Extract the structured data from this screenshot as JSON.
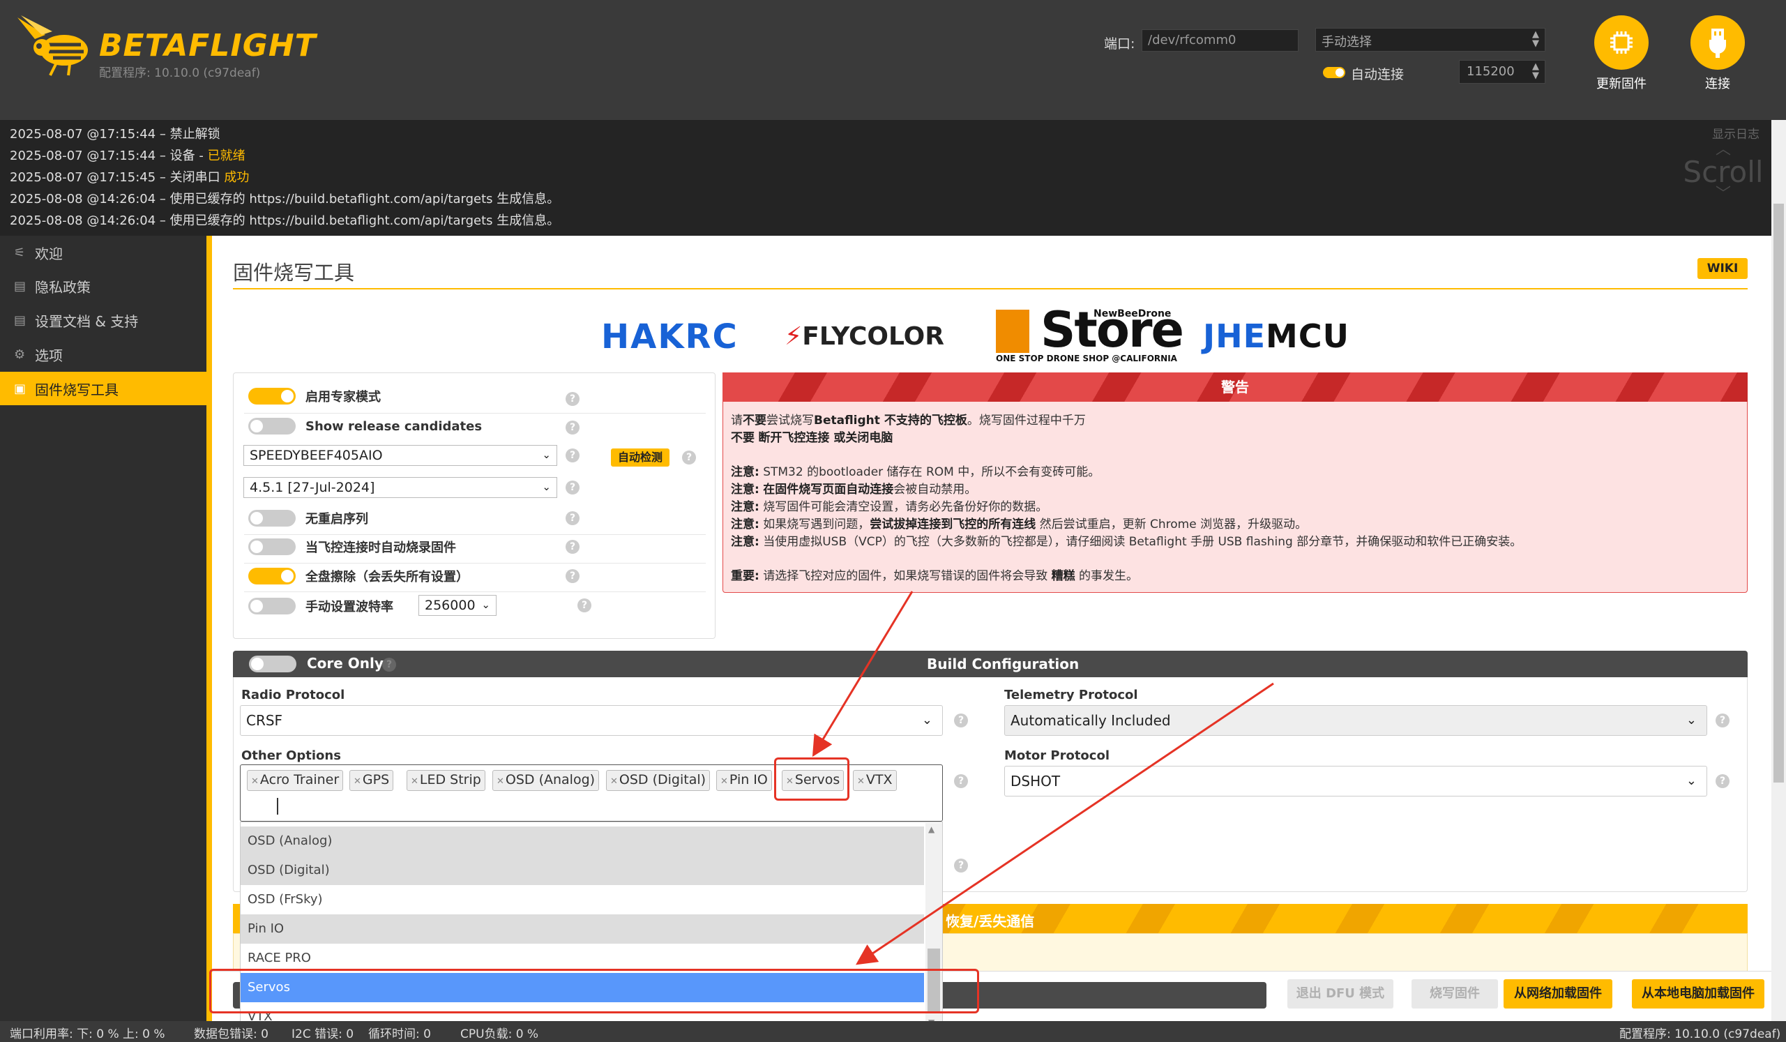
{
  "header": {
    "logo_text": "BETAFLIGHT",
    "config_version": "配置程序: 10.10.0 (c97deaf)",
    "port_label": "端口:",
    "port_value": "/dev/rfcomm0",
    "mode_select": "手动选择",
    "auto_connect_label": "自动连接",
    "baud": "115200",
    "update_firmware_label": "更新固件",
    "connect_label": "连接"
  },
  "log": {
    "lines": [
      {
        "prefix": "2025-08-07 @17:15:44 – ",
        "text": "禁止解锁",
        "accent": ""
      },
      {
        "prefix": "2025-08-07 @17:15:44 – ",
        "text": "设备 - ",
        "accent": "已就绪"
      },
      {
        "prefix": "2025-08-07 @17:15:45 – ",
        "text": "关闭串口 ",
        "accent": "成功"
      },
      {
        "prefix": "2025-08-08 @14:26:04 – ",
        "text": "使用已缓存的 https://build.betaflight.com/api/targets 生成信息。",
        "accent": ""
      },
      {
        "prefix": "2025-08-08 @14:26:04 – ",
        "text": "使用已缓存的 https://build.betaflight.com/api/targets 生成信息。",
        "accent": ""
      }
    ],
    "show_log": "显示日志",
    "scroll": "Scroll"
  },
  "sidebar": {
    "items": [
      {
        "label": "欢迎",
        "icon": "plug-icon"
      },
      {
        "label": "隐私政策",
        "icon": "document-icon"
      },
      {
        "label": "设置文档 & 支持",
        "icon": "book-icon"
      },
      {
        "label": "选项",
        "icon": "gear-icon"
      },
      {
        "label": "固件烧写工具",
        "icon": "chip-icon"
      }
    ]
  },
  "main": {
    "title": "固件烧写工具",
    "wiki": "WIKI",
    "sponsors": {
      "hakrc": "HAKRC",
      "flycolor": "FLYCOLOR",
      "store": "Store",
      "store_top": "NewBeeDrone",
      "store_sub": "ONE STOP DRONE SHOP @CALIFORNIA",
      "jhe": "JHE",
      "mcu": "MCU"
    },
    "options": {
      "expert_mode": "启用专家模式",
      "release_candidates": "Show release candidates",
      "board": "SPEEDYBEEF405AIO",
      "auto_detect": "自动检测",
      "firmware_version": "4.5.1 [27-Jul-2024]",
      "no_reboot": "无重启序列",
      "flash_on_connect": "当飞控连接时自动烧录固件",
      "full_erase": "全盘擦除（会丢失所有设置）",
      "manual_baud": "手动设置波特率",
      "manual_baud_value": "256000"
    },
    "warning": {
      "title": "警告",
      "l1a": "请",
      "l1b": "不要",
      "l1c": "尝试烧写",
      "l1d": "Betaflight 不支持的飞控板",
      "l1e": "。烧写固件过程中千万",
      "l2a": "不要",
      "l2b": "断开飞控连接 或关闭电脑",
      "n1": "注意:",
      "n1t": "STM32 的bootloader 储存在 ROM 中，所以不会有变砖可能。",
      "n2": "注意:",
      "n2a": "在固件烧写页面",
      "n2b": "自动连接",
      "n2c": "会被自动禁用。",
      "n3": "注意:",
      "n3t": "烧写固件可能会清空设置，请务必先备份好你的数据。",
      "n4": "注意:",
      "n4a": "如果烧写遇到问题，",
      "n4b": "尝试拔掉连接到飞控的所有连线",
      "n4c": " 然后尝试重启，更新 Chrome 浏览器，升级驱动。",
      "n5": "注意:",
      "n5t": "当使用虚拟USB（VCP）的飞控（大多数新的飞控都是），请仔细阅读 Betaflight 手册 USB flashing 部分章节，并确保驱动和软件已正确安装。",
      "imp": "重要:",
      "impa": "请选择飞控对应的固件，如果烧写错误的固件将会导致 ",
      "impb": "糟糕",
      "impc": " 的事发生。"
    },
    "build": {
      "core_only": "Core Only",
      "title": "Build Configuration",
      "radio_label": "Radio Protocol",
      "radio_value": "CRSF",
      "telemetry_label": "Telemetry Protocol",
      "telemetry_value": "Automatically Included",
      "other_label": "Other Options",
      "motor_label": "Motor Protocol",
      "motor_value": "DSHOT",
      "tags": [
        "Acro Trainer",
        "GPS",
        "LED Strip",
        "OSD (Analog)",
        "OSD (Digital)",
        "Pin IO",
        "Servos",
        "VTX"
      ],
      "dropdown": [
        "OSD (Analog)",
        "OSD (Digital)",
        "OSD (FrSky)",
        "Pin IO",
        "RACE PRO",
        "Servos",
        "VTX"
      ]
    },
    "recovery_title": "恢复/丢失通信",
    "actions": {
      "exit_dfu": "退出 DFU 模式",
      "flash": "烧写固件",
      "load_online": "从网络加载固件",
      "load_local": "从本地电脑加载固件"
    }
  },
  "status": {
    "port_usage": "端口利用率:  下: 0 % 上: 0 %",
    "packet_error": "数据包错误: 0",
    "i2c_error": "I2C 错误: 0",
    "cycle_time": "循环时间: 0",
    "cpu_load": "CPU负载: 0 %",
    "version": "配置程序: 10.10.0 (c97deaf)"
  },
  "colors": {
    "accent": "#ffbb00",
    "warning_red": "#e34949",
    "selection_blue": "#5897fb",
    "annotation_red": "#e53325"
  }
}
